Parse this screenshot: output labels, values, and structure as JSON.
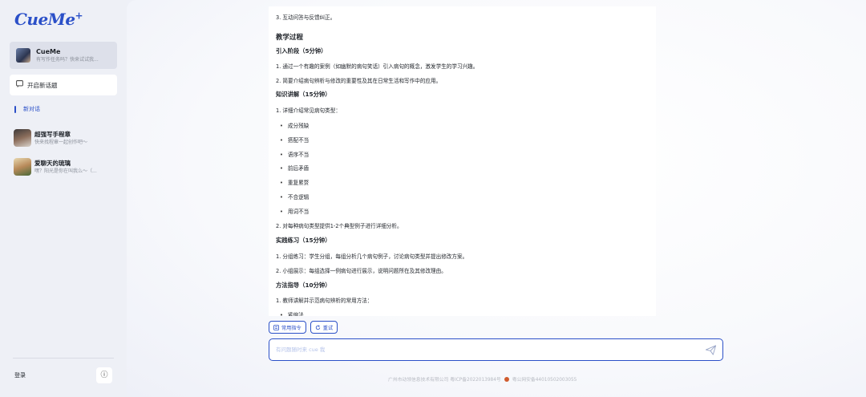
{
  "app": {
    "logo": "CueMe",
    "logo_sup": "+"
  },
  "sidebar": {
    "agent": {
      "name": "CueMe",
      "subtitle": "有写作任务吗？快来试试我..."
    },
    "new_topic_label": "开启新话题",
    "session_label": "新对话",
    "personas": [
      {
        "name": "超强写手程章",
        "subtitle": "快来找程章一起创作吧～"
      },
      {
        "name": "爱聊天的琉璃",
        "subtitle": "嘿？阳光是你在叫我么～（..."
      }
    ],
    "login_label": "登录",
    "info_icon": "ⓘ"
  },
  "content": {
    "lines": [
      {
        "text": "3. 互动问答与反馈纠正。",
        "style": "p"
      },
      {
        "text": "教学过程",
        "style": "h1"
      },
      {
        "text": "引入阶段（5分钟）",
        "style": "h2"
      },
      {
        "text": "1. 通过一个有趣的案例（如幽默的病句笑话）引入病句的概念，激发学生的学习兴趣。",
        "style": "p"
      },
      {
        "text": "2. 简要介绍病句辨析与修改的重要性及其在日常生活和写作中的应用。",
        "style": "p"
      },
      {
        "text": "知识讲解（15分钟）",
        "style": "h2"
      },
      {
        "text": "1. 详细介绍常见病句类型：",
        "style": "p"
      },
      {
        "text": "成分残缺",
        "style": "bullet"
      },
      {
        "text": "搭配不当",
        "style": "bullet"
      },
      {
        "text": "语序不当",
        "style": "bullet"
      },
      {
        "text": "前后矛盾",
        "style": "bullet"
      },
      {
        "text": "重复累赘",
        "style": "bullet"
      },
      {
        "text": "不合逻辑",
        "style": "bullet"
      },
      {
        "text": "用词不当",
        "style": "bullet"
      },
      {
        "text": "2. 对每种病句类型提供1-2个典型例子进行详细分析。",
        "style": "p"
      },
      {
        "text": "实践练习（15分钟）",
        "style": "h2"
      },
      {
        "text": "1. 分组练习：学生分组，每组分析几个病句例子，讨论病句类型并提出修改方案。",
        "style": "p"
      },
      {
        "text": "2. 小组展示：每组选择一例病句进行展示，说明问题所在及其修改理由。",
        "style": "p"
      },
      {
        "text": "方法指导（10分钟）",
        "style": "h2"
      },
      {
        "text": "1. 教师讲解并示范病句辨析的常用方法：",
        "style": "p"
      },
      {
        "text": "紧缩法",
        "style": "bullet"
      }
    ]
  },
  "actions": {
    "commands_label": "常用指令",
    "retry_label": "重试"
  },
  "input": {
    "placeholder": "有问题随时来 cue 我"
  },
  "footer": {
    "icp": "广州市动领信息技术有限公司 粤ICP备2022013984号",
    "police": "粤公网安备44010502003055"
  },
  "colors": {
    "accent": "#2b50c8",
    "police_dot": "#d05b2e"
  }
}
